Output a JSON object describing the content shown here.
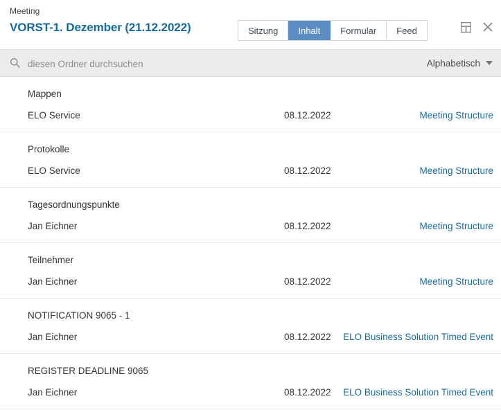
{
  "header": {
    "breadcrumb": "Meeting",
    "title": "VORST-1. Dezember (21.12.2022)",
    "tabs": [
      {
        "label": "Sitzung",
        "active": false
      },
      {
        "label": "Inhalt",
        "active": true
      },
      {
        "label": "Formular",
        "active": false
      },
      {
        "label": "Feed",
        "active": false
      }
    ],
    "icons": [
      {
        "name": "split-view-icon"
      },
      {
        "name": "close-icon"
      }
    ],
    "accent_color": "#5b8dc2",
    "link_color": "#15699e"
  },
  "search": {
    "placeholder": "diesen Ordner durchsuchen",
    "value": "",
    "icon": "search-icon"
  },
  "sort": {
    "label": "Alphabetisch",
    "icon": "chevron-down-icon"
  },
  "list": {
    "rows": [
      {
        "title": "Mappen",
        "author": "ELO Service",
        "date": "08.12.2022",
        "link": "Meeting Structure"
      },
      {
        "title": "Protokolle",
        "author": "ELO Service",
        "date": "08.12.2022",
        "link": "Meeting Structure"
      },
      {
        "title": "Tagesordnungspunkte",
        "author": "Jan Eichner",
        "date": "08.12.2022",
        "link": "Meeting Structure"
      },
      {
        "title": "Teilnehmer",
        "author": "Jan Eichner",
        "date": "08.12.2022",
        "link": "Meeting Structure"
      },
      {
        "title": "NOTIFICATION 9065 - 1",
        "author": "Jan Eichner",
        "date": "08.12.2022",
        "link": "ELO Business Solution Timed Event"
      },
      {
        "title": "REGISTER DEADLINE 9065",
        "author": "Jan Eichner",
        "date": "08.12.2022",
        "link": "ELO Business Solution Timed Event"
      }
    ]
  }
}
